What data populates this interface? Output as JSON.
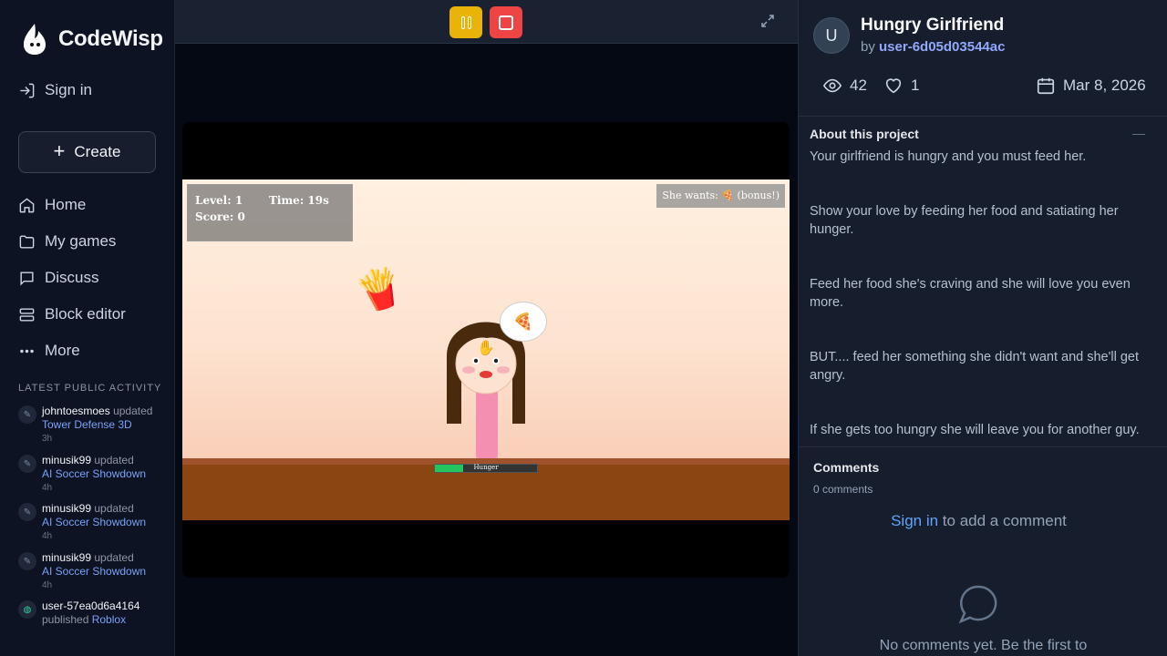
{
  "brand": {
    "name": "CodeWisp"
  },
  "sidebar": {
    "sign_in": "Sign in",
    "create": "Create",
    "nav": [
      {
        "label": "Home",
        "icon": "home-icon"
      },
      {
        "label": "My games",
        "icon": "folder-icon"
      },
      {
        "label": "Discuss",
        "icon": "chat-icon"
      },
      {
        "label": "Block editor",
        "icon": "blocks-icon"
      },
      {
        "label": "More",
        "icon": "more-icon"
      }
    ],
    "activity_title": "Latest public activity",
    "activity": [
      {
        "user": "johntoesmoes",
        "verb": "updated",
        "project": "Tower Defense 3D",
        "time": "3h",
        "icon": "pencil-icon"
      },
      {
        "user": "minusik99",
        "verb": "updated",
        "project": "AI Soccer Showdown",
        "time": "4h",
        "icon": "pencil-icon"
      },
      {
        "user": "minusik99",
        "verb": "updated",
        "project": "AI Soccer Showdown",
        "time": "4h",
        "icon": "pencil-icon"
      },
      {
        "user": "minusik99",
        "verb": "updated",
        "project": "AI Soccer Showdown",
        "time": "4h",
        "icon": "pencil-icon"
      },
      {
        "user": "user-57ea0d6a4164",
        "verb": "published",
        "project": "Roblox",
        "time": "",
        "icon": "globe-icon"
      }
    ]
  },
  "game": {
    "hud": {
      "level": "Level: 1",
      "time": "Time: 19s",
      "score": "Score: 0"
    },
    "wants": "She wants: 🍕 (bonus!)",
    "bubble_food": "🍕",
    "falling_food": "🍟",
    "hunger_label": "Hunger",
    "hunger_level": 0.28
  },
  "project": {
    "avatar_letter": "U",
    "title": "Hungry Girlfriend",
    "by": "by",
    "author": "user-6d05d03544ac",
    "views": "42",
    "likes": "1",
    "date": "Mar 8, 2026",
    "about_title": "About this project",
    "description": [
      "Your girlfriend is hungry and you must feed her.",
      "Show your love by feeding her food and satiating her hunger.",
      "Feed her food she's craving and she will love you even more.",
      "BUT.... feed her something she didn't want and she'll get angry.",
      "If she gets too hungry she will leave you for another guy."
    ]
  },
  "comments": {
    "title": "Comments",
    "count": "0 comments",
    "sign_in": "Sign in",
    "sign_in_suffix": " to add a comment",
    "empty": "No comments yet. Be the first to"
  },
  "colors": {
    "accent": "#60a5fa",
    "pause": "#eab308",
    "stop": "#ef4444",
    "author": "#93a8fb"
  }
}
